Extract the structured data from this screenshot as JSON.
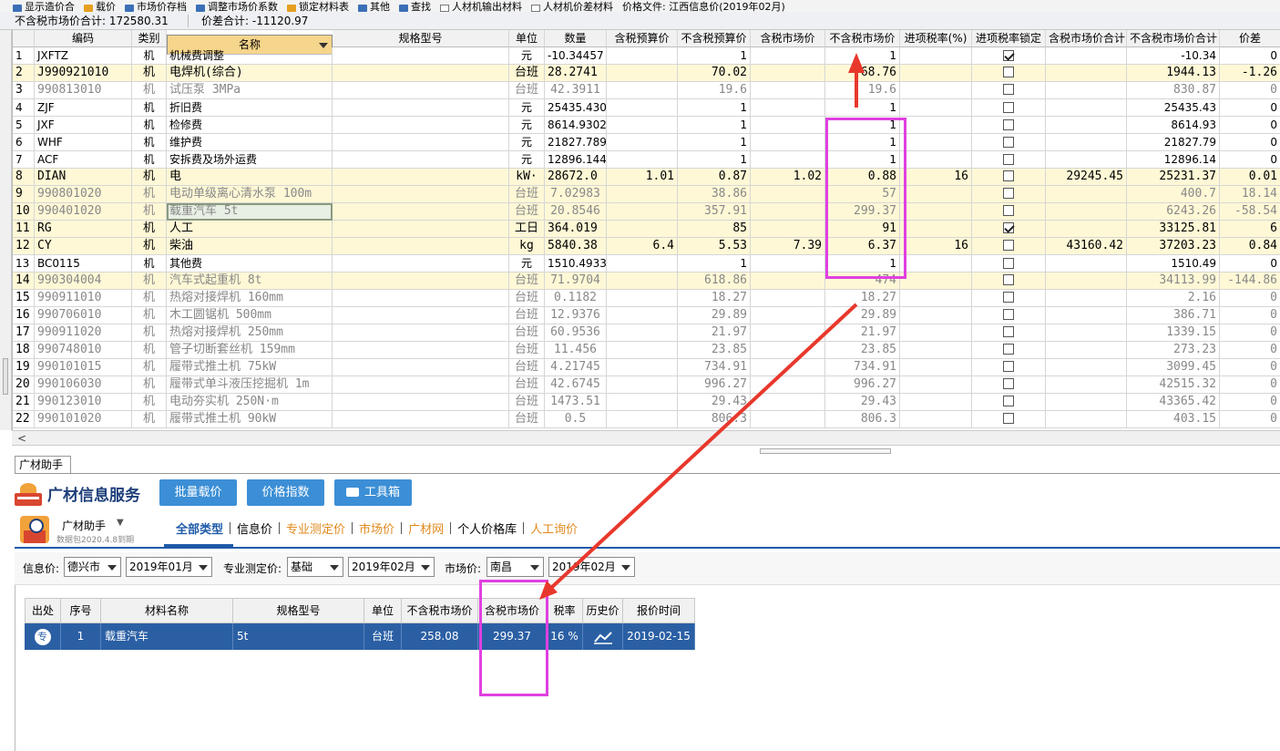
{
  "toolbar": {
    "items": [
      "显示造价合",
      "载价",
      "市场价存档",
      "调整市场价系数",
      "锁定材料表",
      "其他",
      "查找",
      "人材机输出材料",
      "人材机价差材料",
      "价格文件: 江西信息价(2019年02月)"
    ]
  },
  "summary": {
    "excl_tax_total": "不含税市场价合计: 172580.31",
    "diff_total": "价差合计: -11120.97"
  },
  "columns": [
    "编码",
    "类别",
    "名称",
    "规格型号",
    "单位",
    "数量",
    "含税预算价",
    "不含税预算价",
    "含税市场价",
    "不含税市场价",
    "进项税率(%)",
    "进项税率锁定",
    "含税市场价合计",
    "不含税市场价合计",
    "价差"
  ],
  "rows": [
    {
      "no": "1",
      "code": "JXFTZ",
      "type": "机",
      "name": "机械费调整",
      "spec": "",
      "unit": "元",
      "qty": "-10.34457",
      "tax_budget": "",
      "budget": "1",
      "tax_market": "",
      "market": "1",
      "rate": "",
      "lock": true,
      "tax_total": "",
      "total": "-10.34",
      "diff": "0",
      "style": "w"
    },
    {
      "no": "2",
      "code": "J990921010",
      "type": "机",
      "name": "电焊机(综合)",
      "spec": "",
      "unit": "台班",
      "qty": "28.2741",
      "tax_budget": "",
      "budget": "70.02",
      "tax_market": "",
      "market": "68.76",
      "rate": "",
      "lock": false,
      "tax_total": "",
      "total": "1944.13",
      "diff": "-1.26",
      "style": "y"
    },
    {
      "no": "3",
      "code": "990813010",
      "type": "机",
      "name": "试压泵 3MPa",
      "spec": "",
      "unit": "台班",
      "qty": "42.3911",
      "tax_budget": "",
      "budget": "19.6",
      "tax_market": "",
      "market": "19.6",
      "rate": "",
      "lock": false,
      "tax_total": "",
      "total": "830.87",
      "diff": "0",
      "style": "g"
    },
    {
      "no": "4",
      "code": "ZJF",
      "type": "机",
      "name": "折旧费",
      "spec": "",
      "unit": "元",
      "qty": "25435.430",
      "tax_budget": "",
      "budget": "1",
      "tax_market": "",
      "market": "1",
      "rate": "",
      "lock": false,
      "tax_total": "",
      "total": "25435.43",
      "diff": "0",
      "style": "w"
    },
    {
      "no": "5",
      "code": "JXF",
      "type": "机",
      "name": "检修费",
      "spec": "",
      "unit": "元",
      "qty": "8614.9302",
      "tax_budget": "",
      "budget": "1",
      "tax_market": "",
      "market": "1",
      "rate": "",
      "lock": false,
      "tax_total": "",
      "total": "8614.93",
      "diff": "0",
      "style": "w"
    },
    {
      "no": "6",
      "code": "WHF",
      "type": "机",
      "name": "维护费",
      "spec": "",
      "unit": "元",
      "qty": "21827.789",
      "tax_budget": "",
      "budget": "1",
      "tax_market": "",
      "market": "1",
      "rate": "",
      "lock": false,
      "tax_total": "",
      "total": "21827.79",
      "diff": "0",
      "style": "w"
    },
    {
      "no": "7",
      "code": "ACF",
      "type": "机",
      "name": "安拆费及场外运费",
      "spec": "",
      "unit": "元",
      "qty": "12896.144",
      "tax_budget": "",
      "budget": "1",
      "tax_market": "",
      "market": "1",
      "rate": "",
      "lock": false,
      "tax_total": "",
      "total": "12896.14",
      "diff": "0",
      "style": "w"
    },
    {
      "no": "8",
      "code": "DIAN",
      "type": "机",
      "name": "电",
      "spec": "",
      "unit": "kW·",
      "qty": "28672.0",
      "tax_budget": "1.01",
      "budget": "0.87",
      "tax_market": "1.02",
      "market": "0.88",
      "rate": "16",
      "lock": false,
      "tax_total": "29245.45",
      "total": "25231.37",
      "diff": "0.01",
      "style": "y"
    },
    {
      "no": "9",
      "code": "990801020",
      "type": "机",
      "name": "电动单级离心清水泵 100m",
      "spec": "",
      "unit": "台班",
      "qty": "7.02983",
      "tax_budget": "",
      "budget": "38.86",
      "tax_market": "",
      "market": "57",
      "rate": "",
      "lock": false,
      "tax_total": "",
      "total": "400.7",
      "diff": "18.14",
      "style": "yg"
    },
    {
      "no": "10",
      "code": "990401020",
      "type": "机",
      "name": "载重汽车 5t",
      "spec": "",
      "unit": "台班",
      "qty": "20.8546",
      "tax_budget": "",
      "budget": "357.91",
      "tax_market": "",
      "market": "299.37",
      "rate": "",
      "lock": false,
      "tax_total": "",
      "total": "6243.26",
      "diff": "-58.54",
      "style": "yg"
    },
    {
      "no": "11",
      "code": "RG",
      "type": "机",
      "name": "人工",
      "spec": "",
      "unit": "工日",
      "qty": "364.019",
      "tax_budget": "",
      "budget": "85",
      "tax_market": "",
      "market": "91",
      "rate": "",
      "lock": true,
      "tax_total": "",
      "total": "33125.81",
      "diff": "6",
      "style": "y"
    },
    {
      "no": "12",
      "code": "CY",
      "type": "机",
      "name": "柴油",
      "spec": "",
      "unit": "kg",
      "qty": "5840.38",
      "tax_budget": "6.4",
      "budget": "5.53",
      "tax_market": "7.39",
      "market": "6.37",
      "rate": "16",
      "lock": false,
      "tax_total": "43160.42",
      "total": "37203.23",
      "diff": "0.84",
      "style": "y"
    },
    {
      "no": "13",
      "code": "BC0115",
      "type": "机",
      "name": "其他费",
      "spec": "",
      "unit": "元",
      "qty": "1510.4933",
      "tax_budget": "",
      "budget": "1",
      "tax_market": "",
      "market": "1",
      "rate": "",
      "lock": false,
      "tax_total": "",
      "total": "1510.49",
      "diff": "0",
      "style": "w"
    },
    {
      "no": "14",
      "code": "990304004",
      "type": "机",
      "name": "汽车式起重机 8t",
      "spec": "",
      "unit": "台班",
      "qty": "71.9704",
      "tax_budget": "",
      "budget": "618.86",
      "tax_market": "",
      "market": "474",
      "rate": "",
      "lock": false,
      "tax_total": "",
      "total": "34113.99",
      "diff": "-144.86",
      "style": "yg"
    },
    {
      "no": "15",
      "code": "990911010",
      "type": "机",
      "name": "热熔对接焊机 160mm",
      "spec": "",
      "unit": "台班",
      "qty": "0.1182",
      "tax_budget": "",
      "budget": "18.27",
      "tax_market": "",
      "market": "18.27",
      "rate": "",
      "lock": false,
      "tax_total": "",
      "total": "2.16",
      "diff": "0",
      "style": "g"
    },
    {
      "no": "16",
      "code": "990706010",
      "type": "机",
      "name": "木工圆锯机 500mm",
      "spec": "",
      "unit": "台班",
      "qty": "12.9376",
      "tax_budget": "",
      "budget": "29.89",
      "tax_market": "",
      "market": "29.89",
      "rate": "",
      "lock": false,
      "tax_total": "",
      "total": "386.71",
      "diff": "0",
      "style": "g"
    },
    {
      "no": "17",
      "code": "990911020",
      "type": "机",
      "name": "热熔对接焊机 250mm",
      "spec": "",
      "unit": "台班",
      "qty": "60.9536",
      "tax_budget": "",
      "budget": "21.97",
      "tax_market": "",
      "market": "21.97",
      "rate": "",
      "lock": false,
      "tax_total": "",
      "total": "1339.15",
      "diff": "0",
      "style": "g"
    },
    {
      "no": "18",
      "code": "990748010",
      "type": "机",
      "name": "管子切断套丝机 159mm",
      "spec": "",
      "unit": "台班",
      "qty": "11.456",
      "tax_budget": "",
      "budget": "23.85",
      "tax_market": "",
      "market": "23.85",
      "rate": "",
      "lock": false,
      "tax_total": "",
      "total": "273.23",
      "diff": "0",
      "style": "g"
    },
    {
      "no": "19",
      "code": "990101015",
      "type": "机",
      "name": "履带式推土机 75kW",
      "spec": "",
      "unit": "台班",
      "qty": "4.21745",
      "tax_budget": "",
      "budget": "734.91",
      "tax_market": "",
      "market": "734.91",
      "rate": "",
      "lock": false,
      "tax_total": "",
      "total": "3099.45",
      "diff": "0",
      "style": "g"
    },
    {
      "no": "20",
      "code": "990106030",
      "type": "机",
      "name": "履带式单斗液压挖掘机 1m",
      "spec": "",
      "unit": "台班",
      "qty": "42.6745",
      "tax_budget": "",
      "budget": "996.27",
      "tax_market": "",
      "market": "996.27",
      "rate": "",
      "lock": false,
      "tax_total": "",
      "total": "42515.32",
      "diff": "0",
      "style": "g"
    },
    {
      "no": "21",
      "code": "990123010",
      "type": "机",
      "name": "电动夯实机 250N·m",
      "spec": "",
      "unit": "台班",
      "qty": "1473.51",
      "tax_budget": "",
      "budget": "29.43",
      "tax_market": "",
      "market": "29.43",
      "rate": "",
      "lock": false,
      "tax_total": "",
      "total": "43365.42",
      "diff": "0",
      "style": "g"
    },
    {
      "no": "22",
      "code": "990101020",
      "type": "机",
      "name": "履带式推土机 90kW",
      "spec": "",
      "unit": "台班",
      "qty": "0.5",
      "tax_budget": "",
      "budget": "806.3",
      "tax_market": "",
      "market": "806.3",
      "rate": "",
      "lock": false,
      "tax_total": "",
      "total": "403.15",
      "diff": "0",
      "style": "g"
    }
  ],
  "panel": {
    "tab": "广材助手",
    "brand": "广材信息服务",
    "btn_batch": "批量载价",
    "btn_index": "价格指数",
    "btn_tools": "工具箱",
    "helper_name": "广材助手",
    "helper_sub": "数据包2020.4.8到期",
    "nav": [
      "全部类型",
      "信息价",
      "专业测定价",
      "市场价",
      "广材网",
      "个人价格库",
      "人工询价"
    ],
    "filter": {
      "info_label": "信息价:",
      "info_city": "德兴市",
      "info_month": "2019年01月",
      "pro_label": "专业测定价:",
      "pro_type": "基础",
      "pro_month": "2019年02月",
      "market_label": "市场价:",
      "market_city": "南昌",
      "market_month": "2019年02月"
    },
    "result_cols": [
      "出处",
      "序号",
      "材料名称",
      "规格型号",
      "单位",
      "不含税市场价",
      "含税市场价",
      "税率",
      "历史价",
      "报价时间"
    ],
    "result_row": {
      "src": "专",
      "no": "1",
      "name": "载重汽车",
      "spec": "5t",
      "unit": "台班",
      "excl": "258.08",
      "incl": "299.37",
      "rate": "16 %",
      "date": "2019-02-15"
    }
  },
  "colors": {
    "annotation": "#e040e0",
    "arrow": "#e8382c",
    "selected_row": "#2b5fa4",
    "yellow_row": "#fff8d6"
  }
}
